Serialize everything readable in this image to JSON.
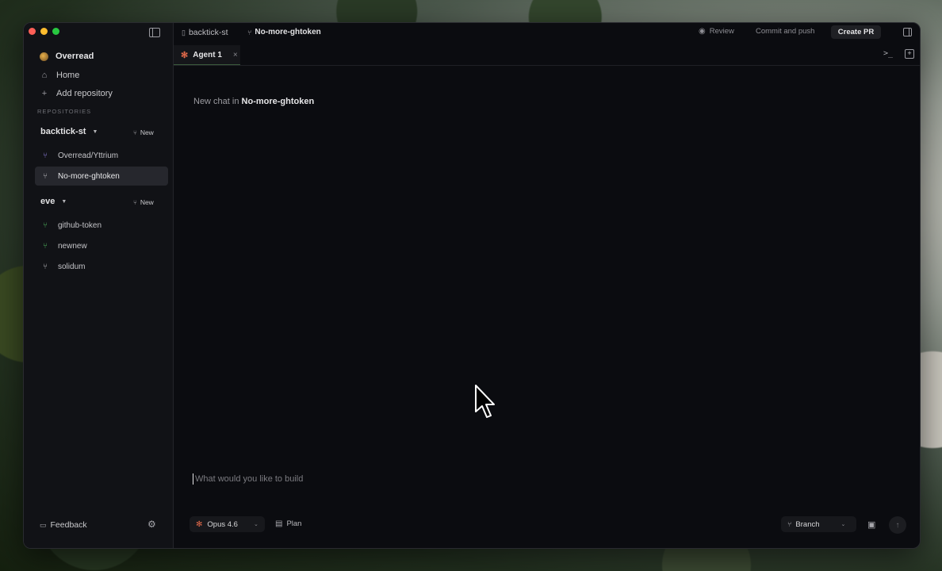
{
  "sidebar": {
    "workspace": "Overread",
    "home": "Home",
    "add_repository": "Add repository",
    "section_title": "REPOSITORIES",
    "repos": [
      {
        "name": "backtick-st",
        "new_label": "New",
        "branches": [
          "Overread/Yttrium",
          "No-more-ghtoken"
        ]
      },
      {
        "name": "eve",
        "new_label": "New",
        "branches": [
          "github-token",
          "newnew",
          "solidum"
        ]
      }
    ],
    "feedback": "Feedback"
  },
  "header": {
    "repo": "backtick-st",
    "branch": "No-more-ghtoken",
    "review": "Review",
    "commit_push": "Commit and push",
    "create_pr": "Create PR"
  },
  "tabs": [
    {
      "label": "Agent 1",
      "close": "×"
    }
  ],
  "main": {
    "newchat_prefix": "New chat in",
    "newchat_branch": "No-more-ghtoken",
    "input_placeholder": "What would you like to build"
  },
  "composer": {
    "model": "Opus 4.6",
    "plan": "Plan",
    "branch": "Branch"
  },
  "colors": {
    "accent_tab_underline": "#3c5a3c",
    "agent_icon": "#e0694a"
  }
}
